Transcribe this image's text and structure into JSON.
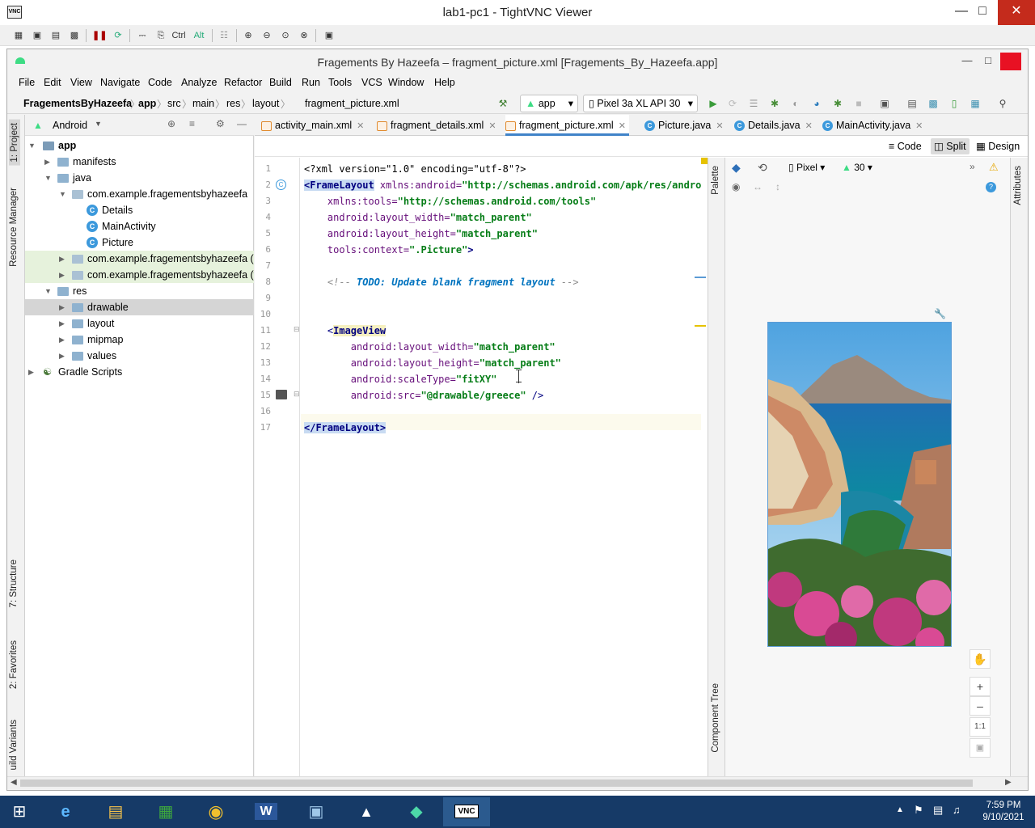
{
  "vnc": {
    "title": "lab1-pc1 - TightVNC Viewer",
    "logo": "VNC",
    "toolbar_ctrl": "Ctrl",
    "toolbar_alt": "Alt"
  },
  "as": {
    "title": "Fragements By Hazeefa – fragment_picture.xml [Fragements_By_Hazeefa.app]"
  },
  "menu": [
    "File",
    "Edit",
    "View",
    "Navigate",
    "Code",
    "Analyze",
    "Refactor",
    "Build",
    "Run",
    "Tools",
    "VCS",
    "Window",
    "Help"
  ],
  "breadcrumb": [
    "FragementsByHazeefa",
    "app",
    "src",
    "main",
    "res",
    "layout",
    "fragment_picture.xml"
  ],
  "run_config": "app",
  "device": "Pixel 3a XL API 30",
  "side_tabs": {
    "project": "1: Project",
    "resource_manager": "Resource Manager",
    "structure": "7: Structure",
    "favorites": "2: Favorites",
    "build_variants": "uild Variants"
  },
  "project": {
    "view": "Android",
    "tree": [
      "app",
      "manifests",
      "java",
      "com.example.fragementsbyhazeefa",
      "Details",
      "MainActivity",
      "Picture",
      "com.example.fragementsbyhazeefa (a",
      "com.example.fragementsbyhazeefa (t",
      "res",
      "drawable",
      "layout",
      "mipmap",
      "values",
      "Gradle Scripts"
    ]
  },
  "tabs": [
    "activity_main.xml",
    "fragment_details.xml",
    "fragment_picture.xml",
    "Picture.java",
    "Details.java",
    "MainActivity.java"
  ],
  "modes": [
    "Code",
    "Split",
    "Design"
  ],
  "line_numbers": [
    "1",
    "2",
    "3",
    "4",
    "5",
    "6",
    "7",
    "8",
    "9",
    "10",
    "11",
    "12",
    "13",
    "14",
    "15",
    "16",
    "17"
  ],
  "code": {
    "l1": "<?xml version=\"1.0\" encoding=\"utf-8\"?>",
    "l2a": "<FrameLayout",
    "l2b": " xmlns:android=",
    "l2c": "\"http://schemas.android.com/apk/res/android",
    "l3a": "    xmlns:tools=",
    "l3b": "\"http://schemas.android.com/tools\"",
    "l4a": "    android:layout_width=",
    "l4b": "\"match_parent\"",
    "l5a": "    android:layout_height=",
    "l5b": "\"match_parent\"",
    "l6a": "    tools:context=",
    "l6b": "\".Picture\"",
    "l6c": ">",
    "l8a": "    <!-- ",
    "l8b": "TODO: Update blank fragment layout",
    "l8c": " -->",
    "l11a": "    <",
    "l11b": "ImageView",
    "l12a": "        android:layout_width=",
    "l12b": "\"match_parent\"",
    "l13a": "        android:layout_height=",
    "l13b": "\"match_parent\"",
    "l14a": "        android:scaleType=",
    "l14b": "\"fitXY\"",
    "l15a": "        android:src=",
    "l15b": "\"@drawable/greece\"",
    "l15c": " />",
    "l17": "</FrameLayout>"
  },
  "design": {
    "device": "Pixel",
    "api": "30",
    "palette": "Palette",
    "component_tree": "Component Tree",
    "attributes": "Attributes",
    "zoom_reset": "1:1"
  },
  "clock": {
    "time": "7:59 PM",
    "date": "9/10/2021"
  }
}
